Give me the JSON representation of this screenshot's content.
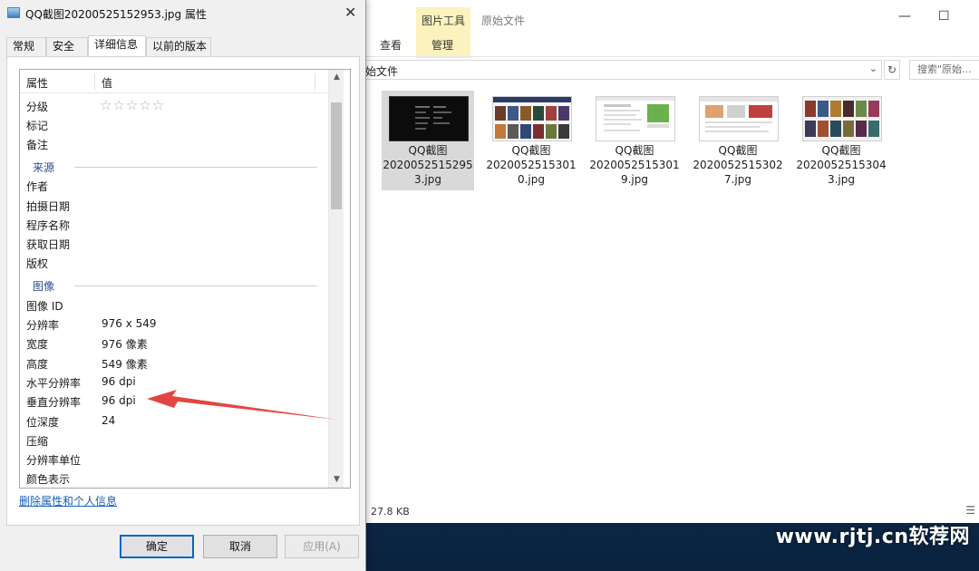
{
  "dialog": {
    "title": "QQ截图20200525152953.jpg 属性",
    "tabs": [
      {
        "label": "常规"
      },
      {
        "label": "安全"
      },
      {
        "label": "详细信息"
      },
      {
        "label": "以前的版本"
      }
    ],
    "active_tab": "详细信息",
    "list": {
      "header": {
        "property": "属性",
        "value": "值"
      },
      "rows": [
        {
          "key": "分级",
          "value": "☆☆☆☆☆"
        },
        {
          "key": "标记",
          "value": ""
        },
        {
          "key": "备注",
          "value": ""
        },
        {
          "section": "来源"
        },
        {
          "key": "作者",
          "value": ""
        },
        {
          "key": "拍摄日期",
          "value": ""
        },
        {
          "key": "程序名称",
          "value": ""
        },
        {
          "key": "获取日期",
          "value": ""
        },
        {
          "key": "版权",
          "value": ""
        },
        {
          "section": "图像"
        },
        {
          "key": "图像 ID",
          "value": ""
        },
        {
          "key": "分辨率",
          "value": "976 x 549"
        },
        {
          "key": "宽度",
          "value": "976 像素"
        },
        {
          "key": "高度",
          "value": "549 像素"
        },
        {
          "key": "水平分辨率",
          "value": "96 dpi"
        },
        {
          "key": "垂直分辨率",
          "value": "96 dpi"
        },
        {
          "key": "位深度",
          "value": "24"
        },
        {
          "key": "压缩",
          "value": ""
        },
        {
          "key": "分辨率单位",
          "value": ""
        },
        {
          "key": "颜色表示",
          "value": ""
        }
      ]
    },
    "remove_link": "删除属性和个人信息",
    "buttons": {
      "ok": "确定",
      "cancel": "取消",
      "apply": "应用(A)"
    }
  },
  "explorer": {
    "ribbon": {
      "context_tab": "图片工具",
      "title": "原始文件",
      "tabs": [
        "查看",
        "管理"
      ],
      "min": "—",
      "max": "☐"
    },
    "address": "始文件",
    "search_placeholder": "搜索\"原始...",
    "files": [
      {
        "line1": "QQ截图",
        "line2": "2020052515295",
        "line3": "3.jpg",
        "selected": true
      },
      {
        "line1": "QQ截图",
        "line2": "2020052515301",
        "line3": "0.jpg",
        "selected": false
      },
      {
        "line1": "QQ截图",
        "line2": "2020052515301",
        "line3": "9.jpg",
        "selected": false
      },
      {
        "line1": "QQ截图",
        "line2": "2020052515302",
        "line3": "7.jpg",
        "selected": false
      },
      {
        "line1": "QQ截图",
        "line2": "2020052515304",
        "line3": "3.jpg",
        "selected": false
      }
    ],
    "status_size": "27.8 KB"
  },
  "watermark": "www.rjtj.cn软荐网",
  "colors": {
    "accent": "#0a64c8",
    "link": "#1a5fb4",
    "section_header": "#2c4c8c",
    "selection": "#d9d9d9",
    "arrow": "#e0322d",
    "context_tab_bg": "#fbf2bd"
  }
}
